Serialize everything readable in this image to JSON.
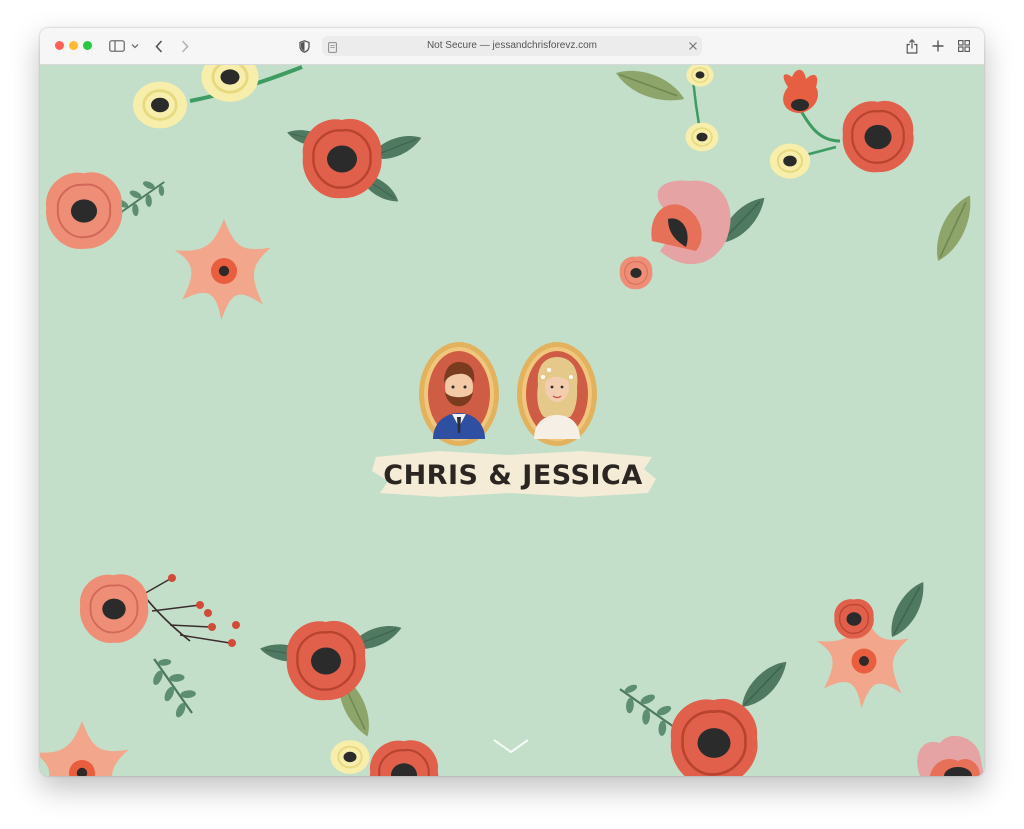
{
  "browser": {
    "address_text": "Not Secure — jessandchrisforevz.com",
    "traffic_lights": {
      "close": "#ff5f57",
      "minimize": "#febc2e",
      "zoom": "#28c840"
    },
    "icons": [
      "sidebar-icon",
      "chevron-down-icon",
      "back-icon",
      "forward-icon",
      "privacy-shield-icon",
      "page-icon",
      "close-icon",
      "share-icon",
      "new-tab-icon",
      "tab-overview-icon"
    ]
  },
  "page": {
    "background_color": "#c3dfc9",
    "couple_title": "CHRIS & JESSICA",
    "scroll_icon": "chevron-down-icon"
  }
}
